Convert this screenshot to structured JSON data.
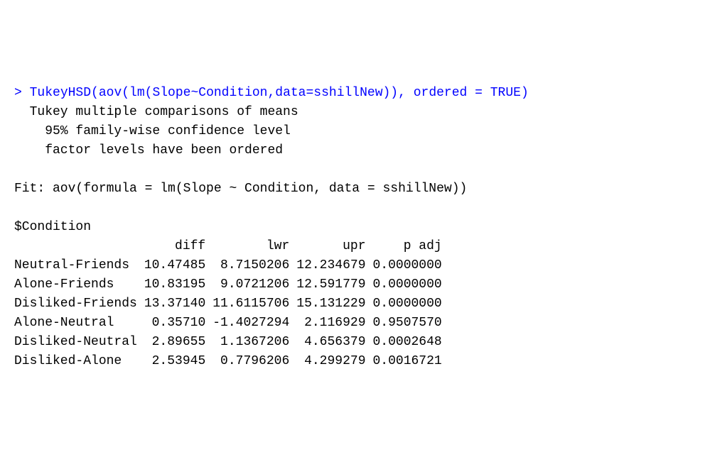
{
  "prompt_symbol": ">",
  "command": "TukeyHSD(aov(lm(Slope~Condition,data=sshillNew)), ordered = TRUE)",
  "header_lines": [
    "  Tukey multiple comparisons of means",
    "    95% family-wise confidence level",
    "    factor levels have been ordered"
  ],
  "fit_line": "Fit: aov(formula = lm(Slope ~ Condition, data = sshillNew))",
  "factor_label": "$Condition",
  "columns": [
    "",
    "diff",
    "lwr",
    "upr",
    "p adj"
  ],
  "rows": [
    {
      "label": "Neutral-Friends",
      "diff": "10.47485",
      "lwr": " 8.7150206",
      "upr": "12.234679",
      "padj": "0.0000000"
    },
    {
      "label": "Alone-Friends",
      "diff": "10.83195",
      "lwr": " 9.0721206",
      "upr": "12.591779",
      "padj": "0.0000000"
    },
    {
      "label": "Disliked-Friends",
      "diff": "13.37140",
      "lwr": "11.6115706",
      "upr": "15.131229",
      "padj": "0.0000000"
    },
    {
      "label": "Alone-Neutral",
      "diff": " 0.35710",
      "lwr": "-1.4027294",
      "upr": " 2.116929",
      "padj": "0.9507570"
    },
    {
      "label": "Disliked-Neutral",
      "diff": " 2.89655",
      "lwr": " 1.1367206",
      "upr": " 4.656379",
      "padj": "0.0002648"
    },
    {
      "label": "Disliked-Alone",
      "diff": " 2.53945",
      "lwr": " 0.7796206",
      "upr": " 4.299279",
      "padj": "0.0016721"
    }
  ]
}
